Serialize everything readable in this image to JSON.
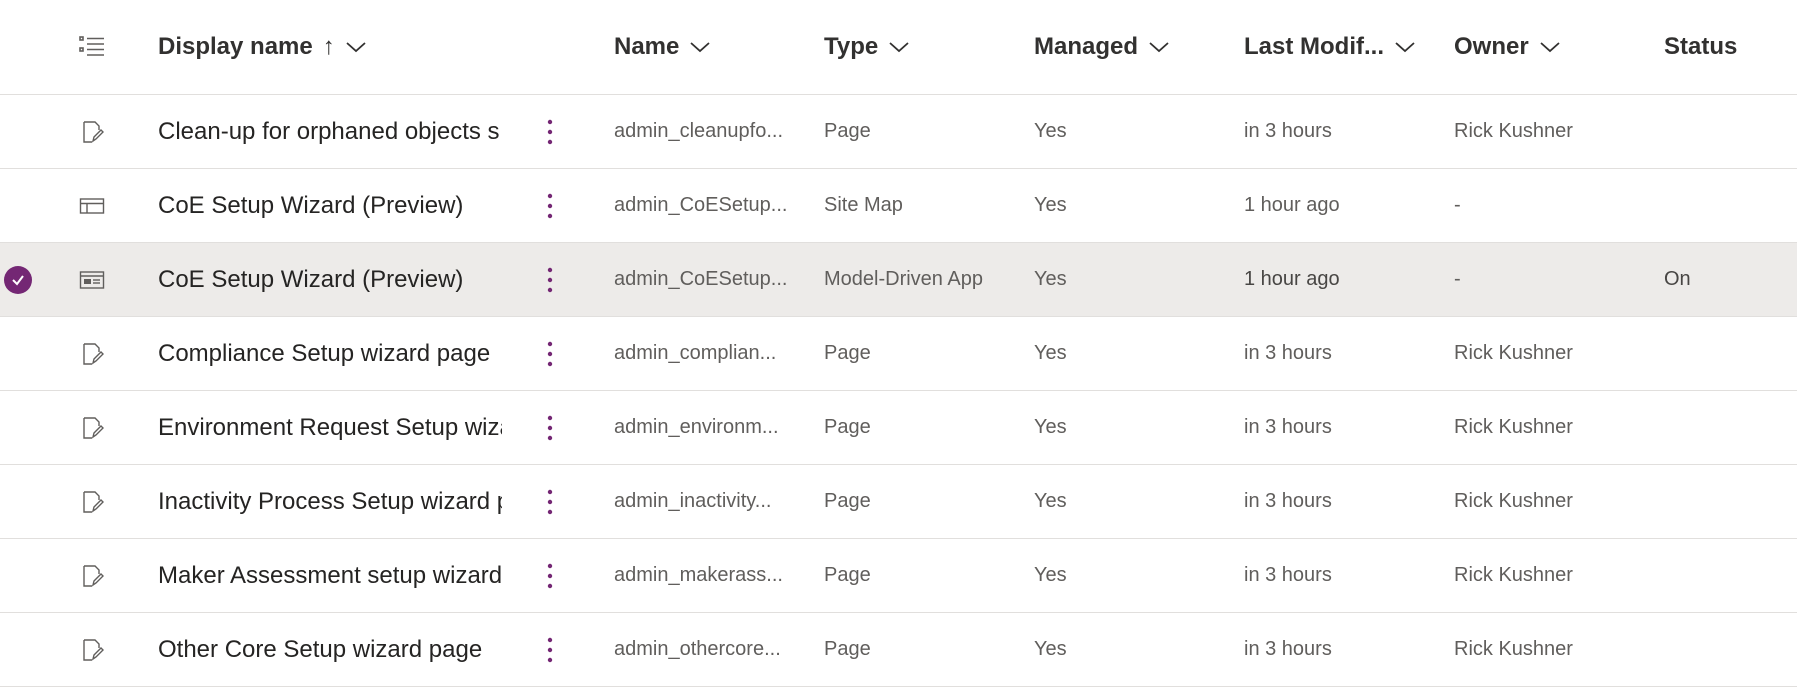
{
  "header": {
    "display_name": "Display name",
    "sort_arrow": "↑",
    "name": "Name",
    "type": "Type",
    "managed": "Managed",
    "last_modified": "Last Modif...",
    "owner": "Owner",
    "status": "Status"
  },
  "colors": {
    "accent": "#742774",
    "selected_row": "#edebe9"
  },
  "rows": [
    {
      "icon": "page-icon",
      "display_name": "Clean-up for orphaned objects s",
      "name": "admin_cleanupfo...",
      "type": "Page",
      "managed": "Yes",
      "modified": "in 3 hours",
      "owner": "Rick Kushner",
      "status": "",
      "selected": false
    },
    {
      "icon": "sitemap-icon",
      "display_name": "CoE Setup Wizard (Preview)",
      "name": "admin_CoESetup...",
      "type": "Site Map",
      "managed": "Yes",
      "modified": "1 hour ago",
      "owner": "-",
      "status": "",
      "selected": false
    },
    {
      "icon": "app-icon",
      "display_name": "CoE Setup Wizard (Preview)",
      "name": "admin_CoESetup...",
      "type": "Model-Driven App",
      "managed": "Yes",
      "modified": "1 hour ago",
      "owner": "-",
      "status": "On",
      "selected": true
    },
    {
      "icon": "page-icon",
      "display_name": "Compliance Setup wizard page",
      "name": "admin_complian...",
      "type": "Page",
      "managed": "Yes",
      "modified": "in 3 hours",
      "owner": "Rick Kushner",
      "status": "",
      "selected": false
    },
    {
      "icon": "page-icon",
      "display_name": "Environment Request Setup wiza",
      "name": "admin_environm...",
      "type": "Page",
      "managed": "Yes",
      "modified": "in 3 hours",
      "owner": "Rick Kushner",
      "status": "",
      "selected": false
    },
    {
      "icon": "page-icon",
      "display_name": "Inactivity Process Setup wizard p",
      "name": "admin_inactivity...",
      "type": "Page",
      "managed": "Yes",
      "modified": "in 3 hours",
      "owner": "Rick Kushner",
      "status": "",
      "selected": false
    },
    {
      "icon": "page-icon",
      "display_name": "Maker Assessment setup wizard",
      "name": "admin_makerass...",
      "type": "Page",
      "managed": "Yes",
      "modified": "in 3 hours",
      "owner": "Rick Kushner",
      "status": "",
      "selected": false
    },
    {
      "icon": "page-icon",
      "display_name": "Other Core Setup wizard page",
      "name": "admin_othercore...",
      "type": "Page",
      "managed": "Yes",
      "modified": "in 3 hours",
      "owner": "Rick Kushner",
      "status": "",
      "selected": false
    }
  ]
}
